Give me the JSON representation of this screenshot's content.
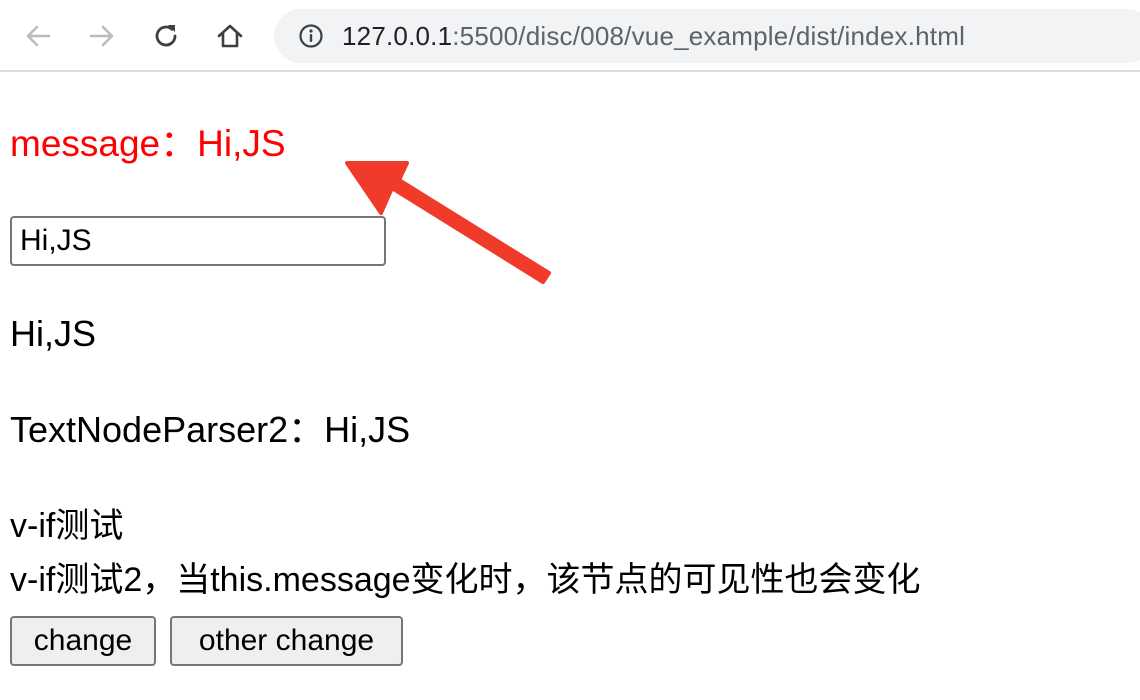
{
  "browser": {
    "url_host": "127.0.0.1",
    "url_rest": ":5500/disc/008/vue_example/dist/index.html"
  },
  "page": {
    "message_line": "message：Hi,JS",
    "input_value": "Hi,JS",
    "echo_text": "Hi,JS",
    "parser_line": "TextNodeParser2：Hi,JS",
    "vif_line": "v-if测试",
    "vif2_line": "v-if测试2，当this.message变化时，该节点的可见性也会变化",
    "change_button_label": "change",
    "other_change_button_label": "other change"
  },
  "colors": {
    "message_text": "#ff0000",
    "annotation_arrow": "#f03a2a"
  },
  "icons": {
    "back": "arrow-left-icon",
    "forward": "arrow-right-icon",
    "reload": "reload-icon",
    "home": "home-icon",
    "site_info": "info-circle-icon"
  }
}
